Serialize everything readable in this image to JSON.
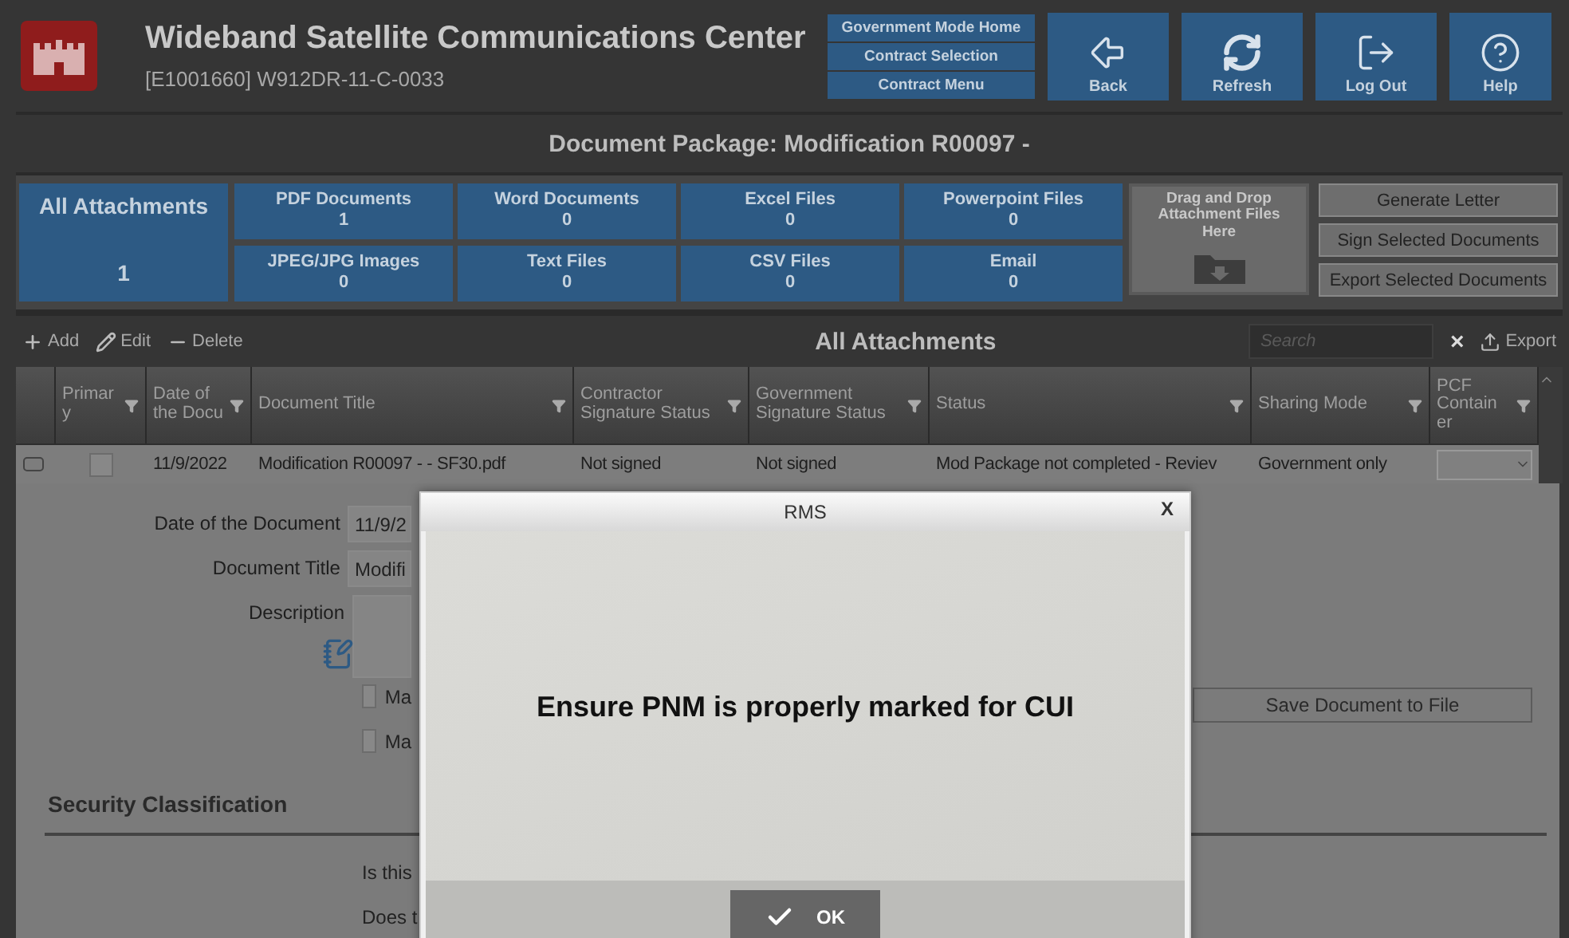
{
  "header": {
    "title": "Wideband Satellite Communications Center",
    "contract": "[E1001660] W912DR-11-C-0033",
    "nav_links": [
      "Government Mode Home",
      "Contract Selection",
      "Contract Menu"
    ],
    "actions": [
      {
        "kind": "back",
        "label": "Back"
      },
      {
        "kind": "refresh",
        "label": "Refresh"
      },
      {
        "kind": "logout",
        "label": "Log Out"
      },
      {
        "kind": "help",
        "label": "Help"
      }
    ]
  },
  "package_title": "Document Package: Modification R00097 -",
  "categories": {
    "all": {
      "label": "All Attachments",
      "count": "1"
    },
    "tiles": [
      {
        "label": "PDF Documents",
        "count": "1"
      },
      {
        "label": "Word Documents",
        "count": "0"
      },
      {
        "label": "Excel Files",
        "count": "0"
      },
      {
        "label": "Powerpoint Files",
        "count": "0"
      },
      {
        "label": "JPEG/JPG Images",
        "count": "0"
      },
      {
        "label": "Text Files",
        "count": "0"
      },
      {
        "label": "CSV Files",
        "count": "0"
      },
      {
        "label": "Email",
        "count": "0"
      }
    ],
    "dropzone": "Drag and Drop Attachment Files Here",
    "side_buttons": [
      "Generate Letter",
      "Sign Selected Documents",
      "Export Selected Documents"
    ]
  },
  "toolbar": {
    "actions": [
      {
        "kind": "add",
        "label": "Add"
      },
      {
        "kind": "edit",
        "label": "Edit"
      },
      {
        "kind": "delete",
        "label": "Delete"
      }
    ],
    "title": "All Attachments",
    "search": {
      "placeholder": "Search"
    },
    "clear": "×",
    "export": "Export"
  },
  "table": {
    "columns": [
      "Primar y",
      "Date of the Docu",
      "Document Title",
      "Contractor Signature Status",
      "Government Signature Status",
      "Status",
      "Sharing Mode",
      "PCF Contain er"
    ],
    "rows": [
      {
        "primary": false,
        "date": "11/9/2022",
        "title": "Modification R00097 -  - SF30.pdf",
        "contractor": "Not signed",
        "government": "Not signed",
        "status": "Mod Package not completed - Reviev",
        "sharing": "Government only"
      }
    ]
  },
  "form": {
    "fields": [
      {
        "kind": "input",
        "label": "Date of the Document",
        "value": "11/9/2"
      },
      {
        "kind": "input",
        "label": "Document Title",
        "value": "Modifi"
      },
      {
        "kind": "textarea",
        "label": "Description"
      }
    ],
    "checkboxes": [
      {
        "label": "Ma",
        "checked": false
      },
      {
        "label": "Ma",
        "checked": false
      }
    ],
    "save_button": "Save Document to File",
    "section": "Security Classification",
    "questions": [
      "Is this",
      "Does t"
    ]
  },
  "dialog": {
    "title": "RMS",
    "close": "X",
    "message": "Ensure PNM is properly marked for CUI",
    "ok": "OK"
  }
}
